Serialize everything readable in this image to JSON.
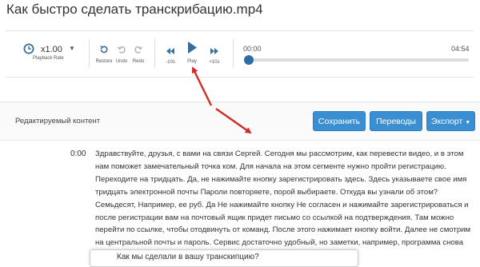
{
  "page": {
    "title": "Как быстро сделать транскрибацию.mp4"
  },
  "player": {
    "rate_value": "x1.00",
    "rate_label": "Playback Rate",
    "restore_label": "Restore",
    "undo_label": "Undo",
    "redo_label": "Redo",
    "rewind_label": "-10s",
    "play_label": "Play",
    "forward_label": "+10s",
    "time_current": "00:00",
    "time_total": "04:54",
    "progress": 0
  },
  "editor": {
    "heading": "Редактируемый контент",
    "buttons": {
      "save": "Сохранить",
      "translations": "Переводы",
      "export": "Экспорт"
    }
  },
  "transcript": {
    "timestamp": "0:00",
    "text": "Здравствуйте, друзья, с вами на связи Сергей. Сегодня мы рассмотрим, как перевести видео, и в этом нам поможет замечательный точка ком. Для начала на этом сегменте нужно пройти регистрацию. Переходите на тридцать. Да, не нажимайте кнопку зарегистрировать здесь. Здесь указываете свое имя тридцать электронной почты Пароли повторяете, порой выбираете. Откуда вы узнали об этом? Семьдесят, Например, ее руб. Да Не нажимайте кнопку Не согласен и нажимайте зарегистрироваться и после регистрации вам на почтовый ящик придет письмо со ссылкой на подтверждения. Там можно перейти по ссылке, чтобы отодвинуть от команд. После этого нажимает кнопку войти. Далее не смотрим на центральной почты и пароль. Сервис достаточно удобный, но заметки, например, программа снова Пройти в нет разнообразия"
  },
  "feedback": {
    "question": "Как мы сделали в вашу транскипцию?"
  },
  "colors": {
    "accent": "#3a8fd3",
    "icon": "#3b6f9c",
    "annotation": "#d42a2a"
  },
  "icons": {
    "rate": "clock-icon",
    "restore": "restore-icon",
    "undo": "undo-icon",
    "redo": "redo-icon",
    "rewind": "rewind-icon",
    "play": "play-icon",
    "forward": "fast-forward-icon"
  }
}
